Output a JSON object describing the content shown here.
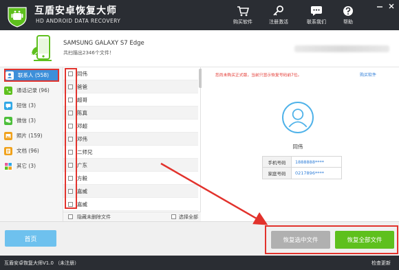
{
  "app": {
    "title": "互盾安卓恢复大师",
    "subtitle": "HD ANDROID DATA RECOVERY"
  },
  "toolbar": {
    "buy_label": "购买软件",
    "register_label": "注册激活",
    "contact_label": "联系我们",
    "help_label": "帮助"
  },
  "device": {
    "name": "SAMSUNG  GALAXY S7 Edge",
    "count_text": "共扫描出2346个文件！"
  },
  "sidebar": {
    "items": [
      {
        "label": "联系人 (558)",
        "icon": "contacts-icon",
        "color": "#3d8fd9"
      },
      {
        "label": "通话记录 (96)",
        "icon": "phone-icon",
        "color": "#5ec01d"
      },
      {
        "label": "短信 (3)",
        "icon": "sms-icon",
        "color": "#2fa7e6"
      },
      {
        "label": "微信 (3)",
        "icon": "wechat-icon",
        "color": "#4cbf3a"
      },
      {
        "label": "照片 (159)",
        "icon": "photo-icon",
        "color": "#f0a21c"
      },
      {
        "label": "文档 (96)",
        "icon": "document-icon",
        "color": "#f0a21c"
      },
      {
        "label": "其它 (3)",
        "icon": "other-icon",
        "color": "#e85c9a"
      }
    ]
  },
  "contacts": {
    "rows": [
      {
        "name": "同伟"
      },
      {
        "name": "爸爸"
      },
      {
        "name": "超哥"
      },
      {
        "name": "陈真"
      },
      {
        "name": "邓超"
      },
      {
        "name": "邓伟"
      },
      {
        "name": "二师兄"
      },
      {
        "name": "广东"
      },
      {
        "name": "方毅"
      },
      {
        "name": "嘉威"
      },
      {
        "name": "嘉威"
      }
    ],
    "hide_undeleted_label": "隐藏未删除文件",
    "select_all_label": "选择全部"
  },
  "detail": {
    "notice": "您尚未购买正式版，当前只显示恢复号码前7位。",
    "buy_link": "购买软件",
    "contact_name": "同伟",
    "fields": [
      {
        "key": "手机号码",
        "value": "1888888****"
      },
      {
        "key": "家庭号码",
        "value": "0217896****"
      }
    ]
  },
  "bottom": {
    "home_label": "首页",
    "recover_selected_label": "恢复选中文件",
    "recover_all_label": "恢复全部文件"
  },
  "status": {
    "version": "互盾安卓恢复大师V1.0 （未注册）",
    "check_update": "检查更新"
  },
  "colors": {
    "titlebar": "#2a2d33",
    "accent_blue": "#3d8fd9",
    "recover_green": "#5ec01d",
    "highlight_red": "#e2322c"
  }
}
